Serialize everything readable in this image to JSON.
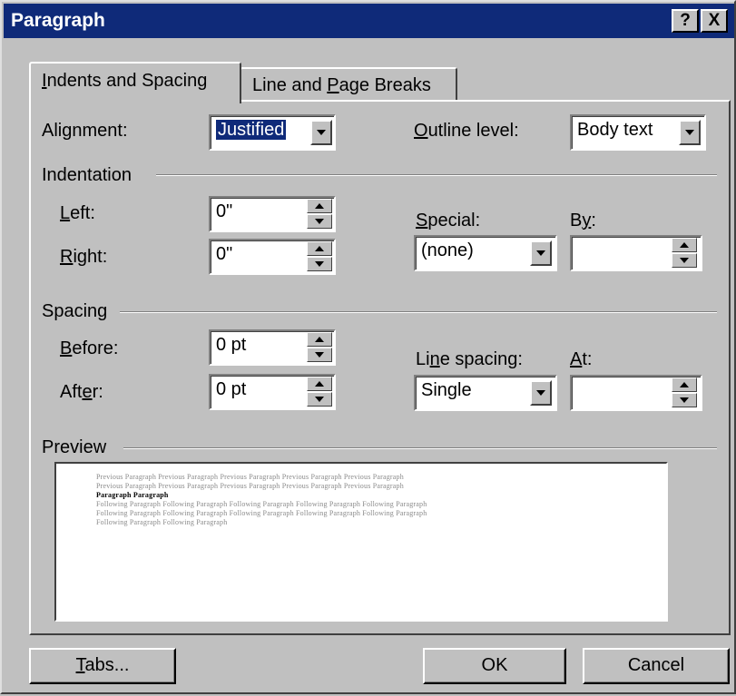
{
  "window": {
    "title": "Paragraph",
    "help_btn": "?",
    "close_btn": "X"
  },
  "tabs": [
    {
      "label_pre": "",
      "label_key": "I",
      "label_post": "ndents and Spacing"
    },
    {
      "label_pre": "Line and ",
      "label_key": "P",
      "label_post": "age Breaks"
    }
  ],
  "general": {
    "alignment_pre": "Ali",
    "alignment_key": "g",
    "alignment_post": "nment:",
    "alignment_value": "Justified",
    "outline_pre": "",
    "outline_key": "O",
    "outline_post": "utline level:",
    "outline_value": "Body text"
  },
  "indentation": {
    "group_label": "Indentation",
    "left_pre": "",
    "left_key": "L",
    "left_post": "eft:",
    "left_value": "0\"",
    "right_pre": "",
    "right_key": "R",
    "right_post": "ight:",
    "right_value": "0\"",
    "special_pre": "",
    "special_key": "S",
    "special_post": "pecial:",
    "special_value": "(none)",
    "by_pre": "B",
    "by_key": "y",
    "by_post": ":",
    "by_value": ""
  },
  "spacing": {
    "group_label": "Spacing",
    "before_pre": "",
    "before_key": "B",
    "before_post": "efore:",
    "before_value": "0 pt",
    "after_pre": "Aft",
    "after_key": "e",
    "after_post": "r:",
    "after_value": "0 pt",
    "line_pre": "Li",
    "line_key": "n",
    "line_post": "e spacing:",
    "line_value": "Single",
    "at_pre": "",
    "at_key": "A",
    "at_post": "t:",
    "at_value": ""
  },
  "preview": {
    "group_label": "Preview",
    "lines": [
      "Previous Paragraph Previous Paragraph Previous Paragraph Previous Paragraph Previous Paragraph",
      "Previous Paragraph Previous Paragraph Previous Paragraph Previous Paragraph Previous Paragraph",
      "Paragraph Paragraph",
      "Following Paragraph Following Paragraph Following Paragraph Following Paragraph Following Paragraph",
      "Following Paragraph Following Paragraph Following Paragraph Following Paragraph Following Paragraph",
      "Following Paragraph Following Paragraph"
    ]
  },
  "buttons": {
    "tabs_pre": "",
    "tabs_key": "T",
    "tabs_post": "abs...",
    "ok": "OK",
    "cancel": "Cancel"
  },
  "colors": {
    "titlebar": "#0f2a79",
    "face": "#c0c0c0"
  }
}
